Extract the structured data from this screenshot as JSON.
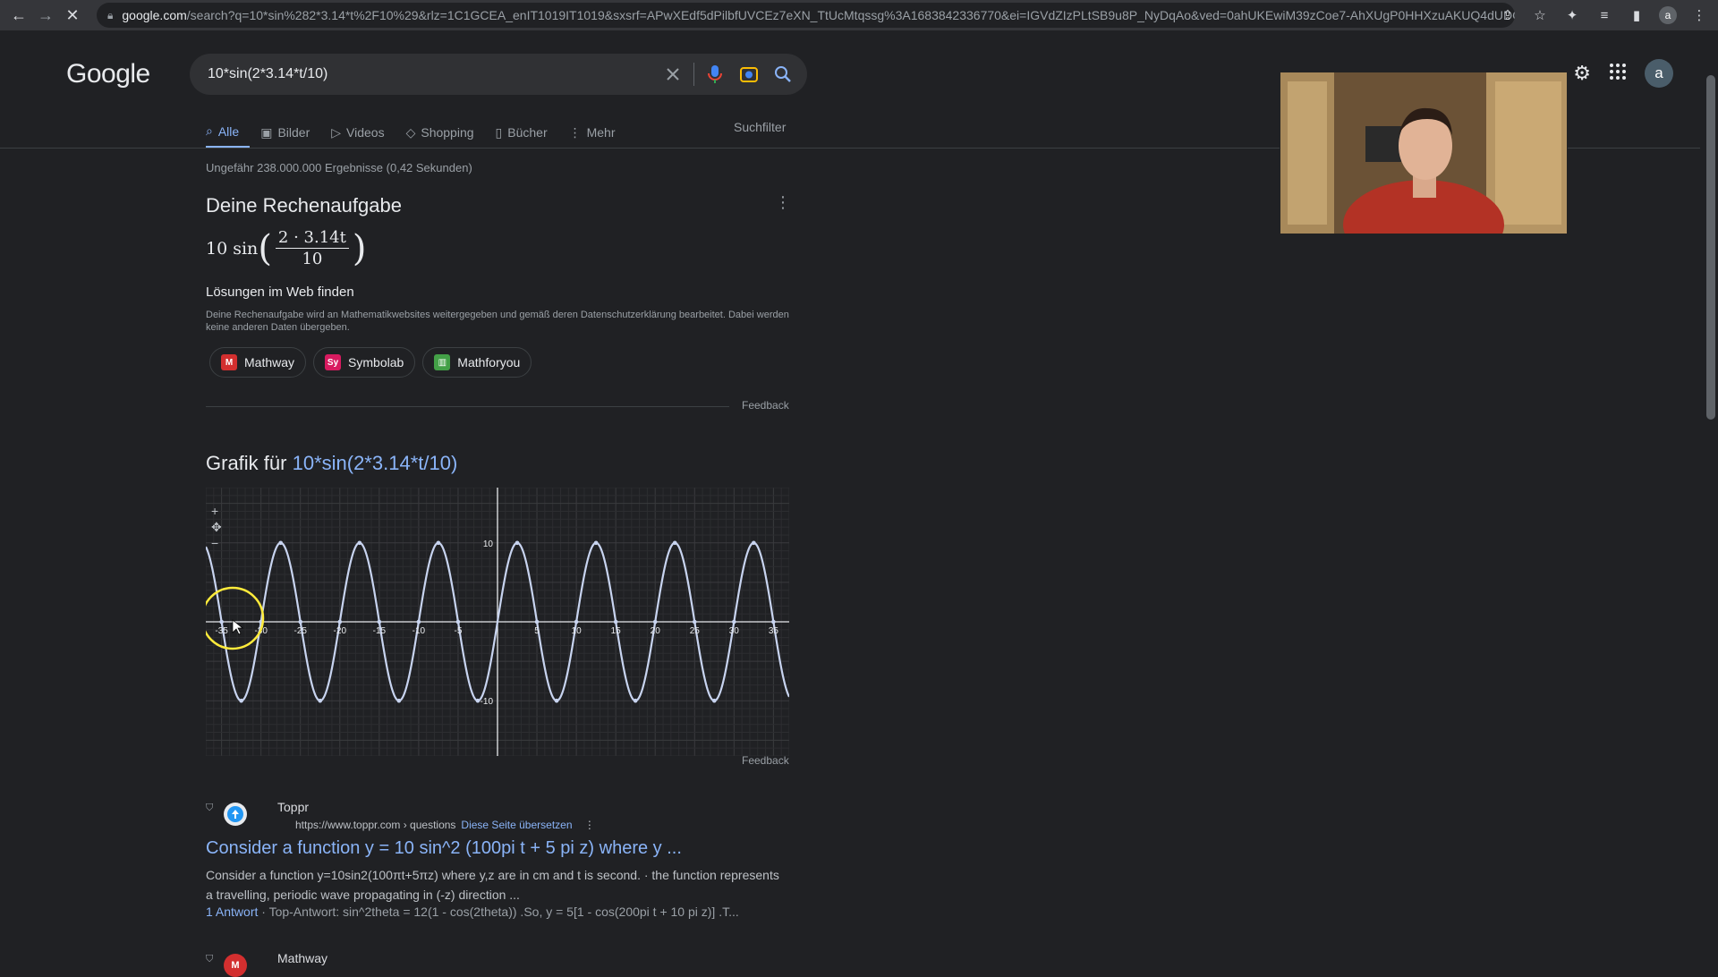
{
  "browser": {
    "url_host": "google.com",
    "url_rest": "/search?q=10*sin%282*3.14*t%2F10%29&rlz=1C1GCEA_enIT1019IT1019&sxsrf=APwXEdf5dPilbfUVCEz7eXN_TtUcMtqssg%3A1683842336770&ei=IGVdZIzPLtSB9u8P_NyDqAo&ved=0ahUKEwiM39zCoe7-AhXUgP0HHXzuAKUQ4dUDCA8...",
    "profile_letter": "a"
  },
  "header": {
    "logo": "Google",
    "query": "10*sin(2*3.14*t/10)",
    "avatar_letter": "a"
  },
  "tabs": [
    {
      "label": "Alle",
      "icon": "search-icon"
    },
    {
      "label": "Bilder",
      "icon": "image-icon"
    },
    {
      "label": "Videos",
      "icon": "play-icon"
    },
    {
      "label": "Shopping",
      "icon": "tag-icon"
    },
    {
      "label": "Bücher",
      "icon": "book-icon"
    },
    {
      "label": "Mehr",
      "icon": "more-vert-icon"
    }
  ],
  "suchfilter": "Suchfilter",
  "stats": "Ungefähr 238.000.000 Ergebnisse (0,42 Sekunden)",
  "calc": {
    "title": "Deine Rechenaufgabe",
    "formula_coef": "10",
    "formula_fn": "sin",
    "formula_num": "2 · 3.14t",
    "formula_den": "10",
    "web_title": "Lösungen im Web finden",
    "web_note": "Deine Rechenaufgabe wird an Mathematikwebsites weitergegeben und gemäß deren Datenschutzerklärung bearbeitet. Dabei werden keine anderen Daten übergeben.",
    "chips": [
      {
        "label": "Mathway",
        "logo": "M",
        "color": "#d32f2f"
      },
      {
        "label": "Symbolab",
        "logo": "Sy",
        "color": "#d81b60"
      },
      {
        "label": "Mathforyou",
        "logo": "▥",
        "color": "#43a047"
      }
    ],
    "feedback": "Feedback"
  },
  "graph": {
    "title_prefix": "Grafik für",
    "title_expr": "10*sin(2*3.14*t/10)",
    "feedback": "Feedback",
    "zoom_in": "+",
    "zoom_out": "−"
  },
  "chart_data": {
    "type": "line",
    "function": "10*sin(2*3.14*t/10)",
    "xlim": [
      -37,
      37
    ],
    "ylim": [
      -17,
      17
    ],
    "x_ticks": [
      -35,
      -30,
      -25,
      -20,
      -15,
      -10,
      -5,
      5,
      10,
      15,
      20,
      25,
      30,
      35
    ],
    "x_tick_labels": [
      "-35",
      "-30",
      "-25",
      "-20",
      "-15",
      "-10",
      "-5",
      "5",
      "10",
      "15",
      "20",
      "25",
      "30",
      "35"
    ],
    "y_ticks": [
      10,
      -10
    ],
    "y_tick_labels": [
      "10",
      "-10"
    ],
    "amplitude": 10,
    "period": 10,
    "grid": true,
    "series_color": "#c8d4f0"
  },
  "results": [
    {
      "site": "Toppr",
      "url": "https://www.toppr.com › questions",
      "translate": "Diese Seite übersetzen",
      "title": "Consider a function y = 10 sin^2 (100pi t + 5 pi z) where y ...",
      "snippet": "Consider a function y=10sin2(100πt+5πz) where y,z are in cm and t is second. · the function represents a travelling, periodic wave propagating in (-z) direction ...",
      "answers_link": "1 Antwort",
      "top_answer": " · Top-Antwort: sin^2theta = 12(1 - cos(2theta)) .So, y = 5[1 - cos(200pi t + 10 pi z)] .T..."
    },
    {
      "site": "Mathway"
    }
  ]
}
